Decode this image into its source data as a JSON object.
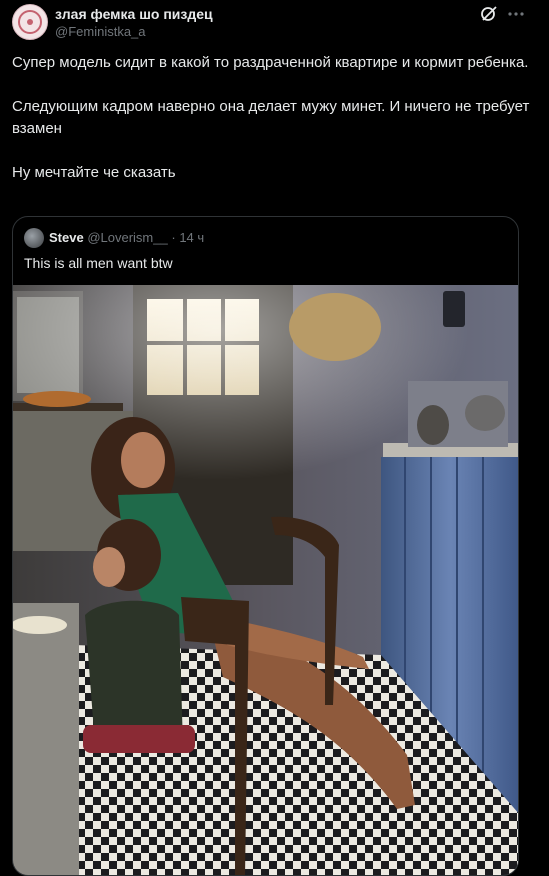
{
  "author": {
    "display_name": "злая фемка шо пиздец",
    "handle": "@Feministka_a"
  },
  "icons": [
    "grok-icon",
    "more-icon"
  ],
  "tweet": {
    "paragraphs": [
      "Супер модель сидит в какой то раздраченной квартире и кормит ребенка.",
      "Следующим кадром наверно она делает мужу минет. И ничего не требует взамен",
      "Ну мечтайте че сказать"
    ]
  },
  "quoted": {
    "display_name": "Steve",
    "handle": "@Loverism__",
    "separator": "·",
    "time": "14 ч",
    "text": "This is all men want btw"
  },
  "colors": {
    "background": "#000000",
    "text": "#e7e9ea",
    "secondary": "#71767b",
    "border": "#2f3336"
  }
}
